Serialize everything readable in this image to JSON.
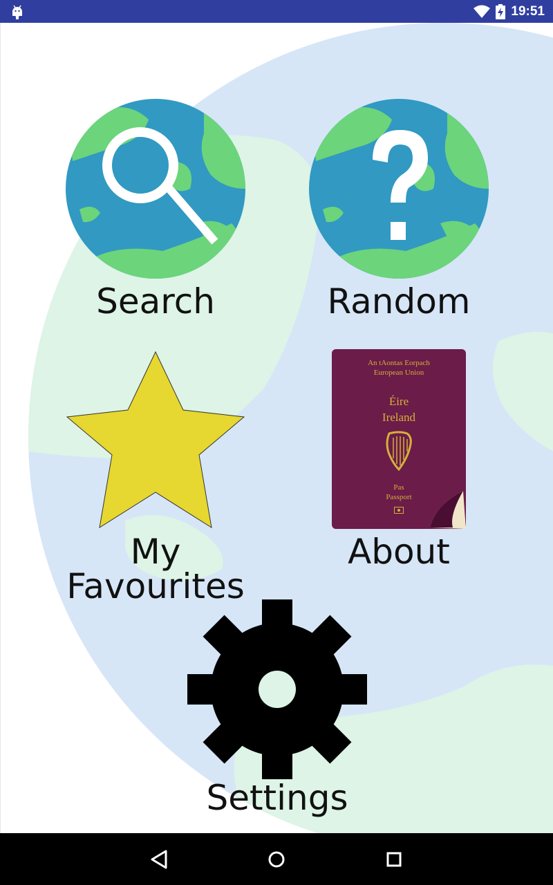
{
  "status_bar": {
    "time": "19:51",
    "icons": [
      "android-debug-icon",
      "wifi-icon",
      "battery-charging-icon"
    ]
  },
  "menu": {
    "search_label": "Search",
    "random_label": "Random",
    "favourites_label": "My Favourites",
    "about_label": "About",
    "settings_label": "Settings"
  },
  "passport": {
    "line1": "An tAontas Eorpach",
    "line2": "European Union",
    "country_ga": "Éire",
    "country_en": "Ireland",
    "word_ga": "Pas",
    "word_en": "Passport"
  },
  "nav_bar": {
    "icons": [
      "back-icon",
      "home-icon",
      "recents-icon"
    ]
  },
  "colors": {
    "status_bar": "#303f9f",
    "globe_ocean": "#3199c2",
    "globe_land": "#6cd47b",
    "bg_ocean": "#d6e6f7",
    "bg_land": "#ddf4e6",
    "star": "#e6d731",
    "passport": "#6b1c49",
    "gold": "#d4b03a"
  }
}
